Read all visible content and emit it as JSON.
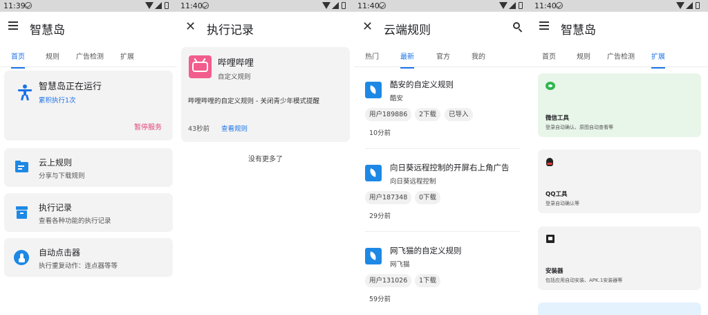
{
  "screens": [
    {
      "status_time": "11:39",
      "app_title": "智慧岛",
      "tabs": [
        "首页",
        "规则",
        "广告检测",
        "扩展"
      ],
      "status_card": {
        "title": "智慧岛正在运行",
        "count": "累积执行1次",
        "pause": "暂停服务"
      },
      "tools": [
        {
          "title": "云上规则",
          "desc": "分享与下载规则",
          "icon": "folder-icon"
        },
        {
          "title": "执行记录",
          "desc": "查看各种功能的执行记录",
          "icon": "archive-box-icon"
        },
        {
          "title": "自动点击器",
          "desc": "执行重复动作：连点器等等",
          "icon": "tap-icon"
        }
      ]
    },
    {
      "status_time": "11:40",
      "app_title": "执行记录",
      "record": {
        "app_name": "哔哩哔哩",
        "rule_type": "自定义规则",
        "description": "哔哩哔哩的自定义规则 - 关闭青少年模式提醒",
        "time": "43秒前",
        "view_rule": "查看规则"
      },
      "no_more": "没有更多了"
    },
    {
      "status_time": "11:40",
      "app_title": "云端规则",
      "tabs": [
        "热门",
        "最新",
        "官方",
        "我的"
      ],
      "rules": [
        {
          "title": "酷安的自定义规则",
          "app": "酷安",
          "user": "用户189886",
          "downloads": "2下载",
          "imported": "已导入",
          "time": "10分前"
        },
        {
          "title": "向日葵远程控制的开屏右上角广告",
          "app": "向日葵远程控制",
          "user": "用户187348",
          "downloads": "0下载",
          "imported": "",
          "time": "29分前"
        },
        {
          "title": "网飞猫的自定义规则",
          "app": "网飞猫",
          "user": "用户131026",
          "downloads": "1下载",
          "imported": "",
          "time": "59分前"
        }
      ]
    },
    {
      "status_time": "11:40",
      "app_title": "智慧岛",
      "tabs": [
        "首页",
        "规则",
        "广告检测",
        "扩展"
      ],
      "extensions": [
        {
          "title": "微信工具",
          "desc": "登录自动确认、原图自动查看等",
          "bg": "#e8f5e9",
          "icon": "wechat-icon"
        },
        {
          "title": "QQ工具",
          "desc": "登录自动确认等",
          "bg": "#f3f3f3",
          "icon": "qq-icon"
        },
        {
          "title": "安装器",
          "desc": "包括应用自动安装、APK.1安装器等",
          "bg": "#f3f3f3",
          "icon": "apk-icon"
        }
      ]
    }
  ],
  "colors": {
    "accent": "#1a73e8",
    "pause": "#e0457b",
    "bilibili": "#f25d8e",
    "wechat": "#2db84d"
  }
}
